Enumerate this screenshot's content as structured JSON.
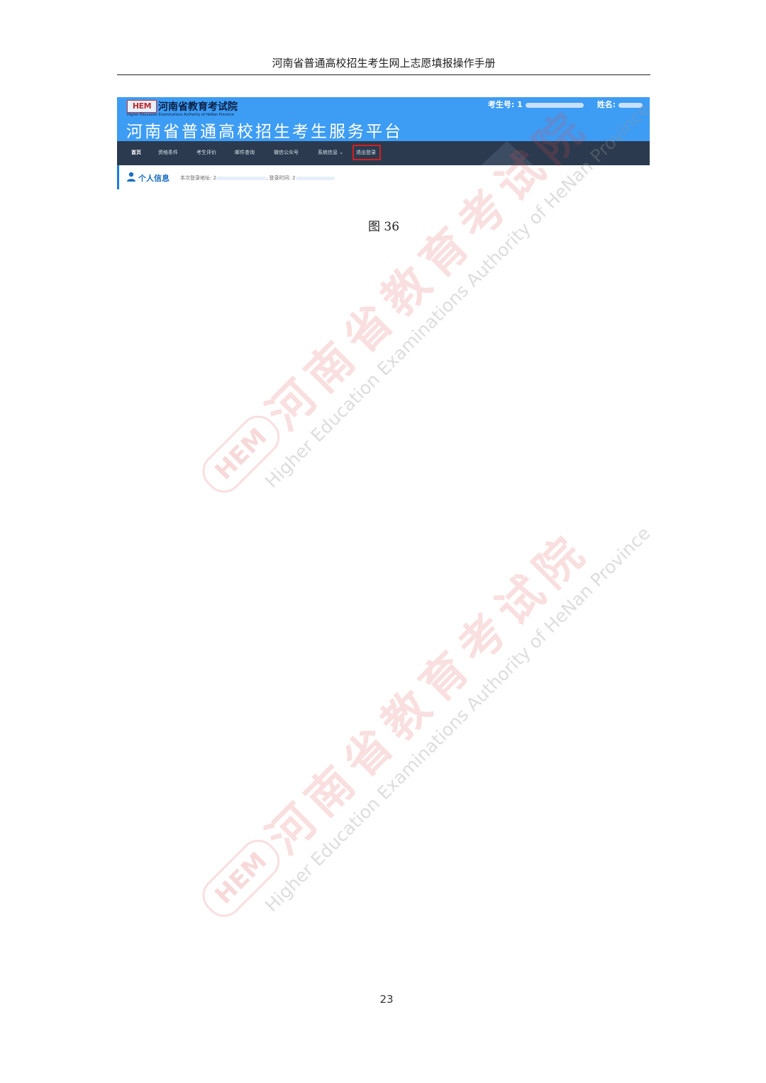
{
  "document": {
    "running_header": "河南省普通高校招生考生网上志愿填报操作手册",
    "figure_caption": "图 36",
    "page_number": "23"
  },
  "screenshot": {
    "logo_text": "HEM",
    "org_name": "河南省教育考试院",
    "org_name_en": "Higher Education Examinations Authority of HeNan Province",
    "platform_title": "河南省普通高校招生考生服务平台",
    "candidate_no_label": "考生号:",
    "candidate_no_value": "1",
    "name_label": "姓名:",
    "nav_items": [
      {
        "label": "首页"
      },
      {
        "label": "资格条件"
      },
      {
        "label": "考生评价"
      },
      {
        "label": "邮件查询"
      },
      {
        "label": "微信公众号"
      },
      {
        "label": "系统信息"
      },
      {
        "label": "退出登录"
      }
    ],
    "info_title": "个人信息",
    "info_login_addr_label": "本次登录地址:",
    "info_login_addr_value": "2",
    "info_login_time_label": "登录时间:",
    "info_login_time_value": "2",
    "colors": {
      "banner": "#3d9cf3",
      "nav": "#2b3a4e",
      "highlight": "#d42020"
    }
  },
  "watermark": {
    "logo": "HEM",
    "text_cn": "河南省教育考试院",
    "text_en": "Higher Education Examinations Authority of HeNan Province"
  }
}
